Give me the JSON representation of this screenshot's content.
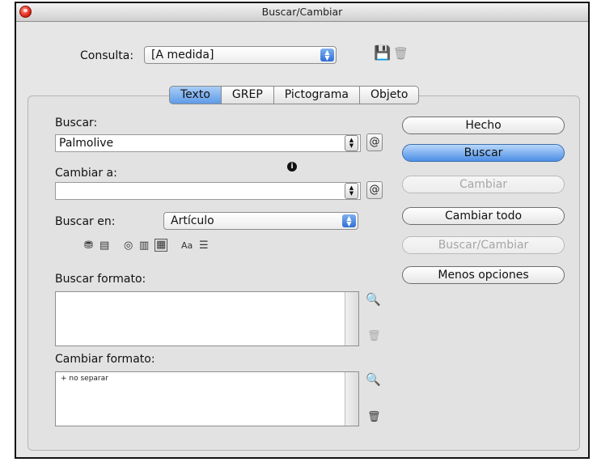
{
  "window": {
    "title": "Buscar/Cambiar"
  },
  "query": {
    "label": "Consulta:",
    "value": "[A medida]"
  },
  "tabs": [
    {
      "label": "Texto",
      "selected": true
    },
    {
      "label": "GREP",
      "selected": false
    },
    {
      "label": "Pictograma",
      "selected": false
    },
    {
      "label": "Objeto",
      "selected": false
    }
  ],
  "find": {
    "label": "Buscar:",
    "value": "Palmolive"
  },
  "change": {
    "label": "Cambiar a:",
    "value": ""
  },
  "search_in": {
    "label": "Buscar en:",
    "value": "Artículo"
  },
  "search_options_icons": [
    "locked-layers-icon",
    "locked-stories-icon",
    "hidden-layers-icon",
    "master-pages-icon",
    "footnotes-icon",
    "case-sensitive-icon",
    "whole-word-icon"
  ],
  "find_format": {
    "label": "Buscar formato:",
    "items": []
  },
  "change_format": {
    "label": "Cambiar formato:",
    "items": [
      "+ no separar"
    ]
  },
  "buttons": {
    "done": "Hecho",
    "find": "Buscar",
    "change": "Cambiar",
    "change_all": "Cambiar todo",
    "find_change": "Buscar/Cambiar",
    "fewer_options": "Menos opciones"
  },
  "case_label": "Aa",
  "colors": {
    "accent": "#5e9be8",
    "close": "#e0261a"
  }
}
